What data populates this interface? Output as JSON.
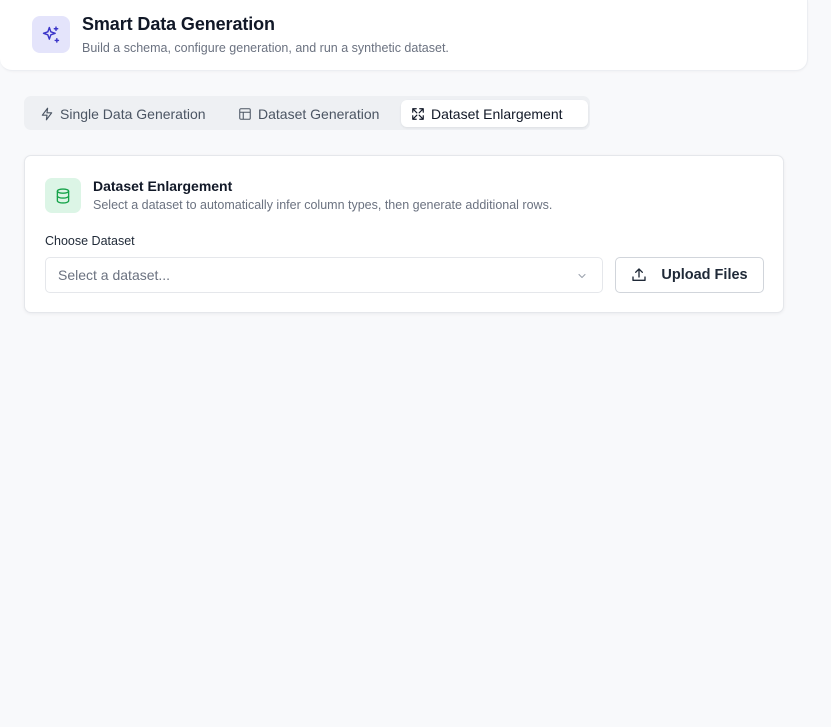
{
  "header": {
    "title": "Smart Data Generation",
    "subtitle": "Build a schema, configure generation, and run a synthetic dataset.",
    "icon": "sparkles-icon"
  },
  "tabs": [
    {
      "label": "Single Data Generation",
      "icon": "lightning-icon",
      "active": false
    },
    {
      "label": "Dataset Generation",
      "icon": "table-icon",
      "active": false
    },
    {
      "label": "Dataset Enlargement",
      "icon": "expand-icon",
      "active": true
    }
  ],
  "card": {
    "title": "Dataset Enlargement",
    "description": "Select a dataset to automatically infer column types, then generate additional rows.",
    "icon": "database-icon",
    "field_label": "Choose Dataset",
    "select_placeholder": "Select a dataset...",
    "upload_label": "Upload Files"
  },
  "colors": {
    "page_bg": "#f8f9fb",
    "accent_purple": "#4338ca",
    "accent_green": "#16a34a"
  }
}
